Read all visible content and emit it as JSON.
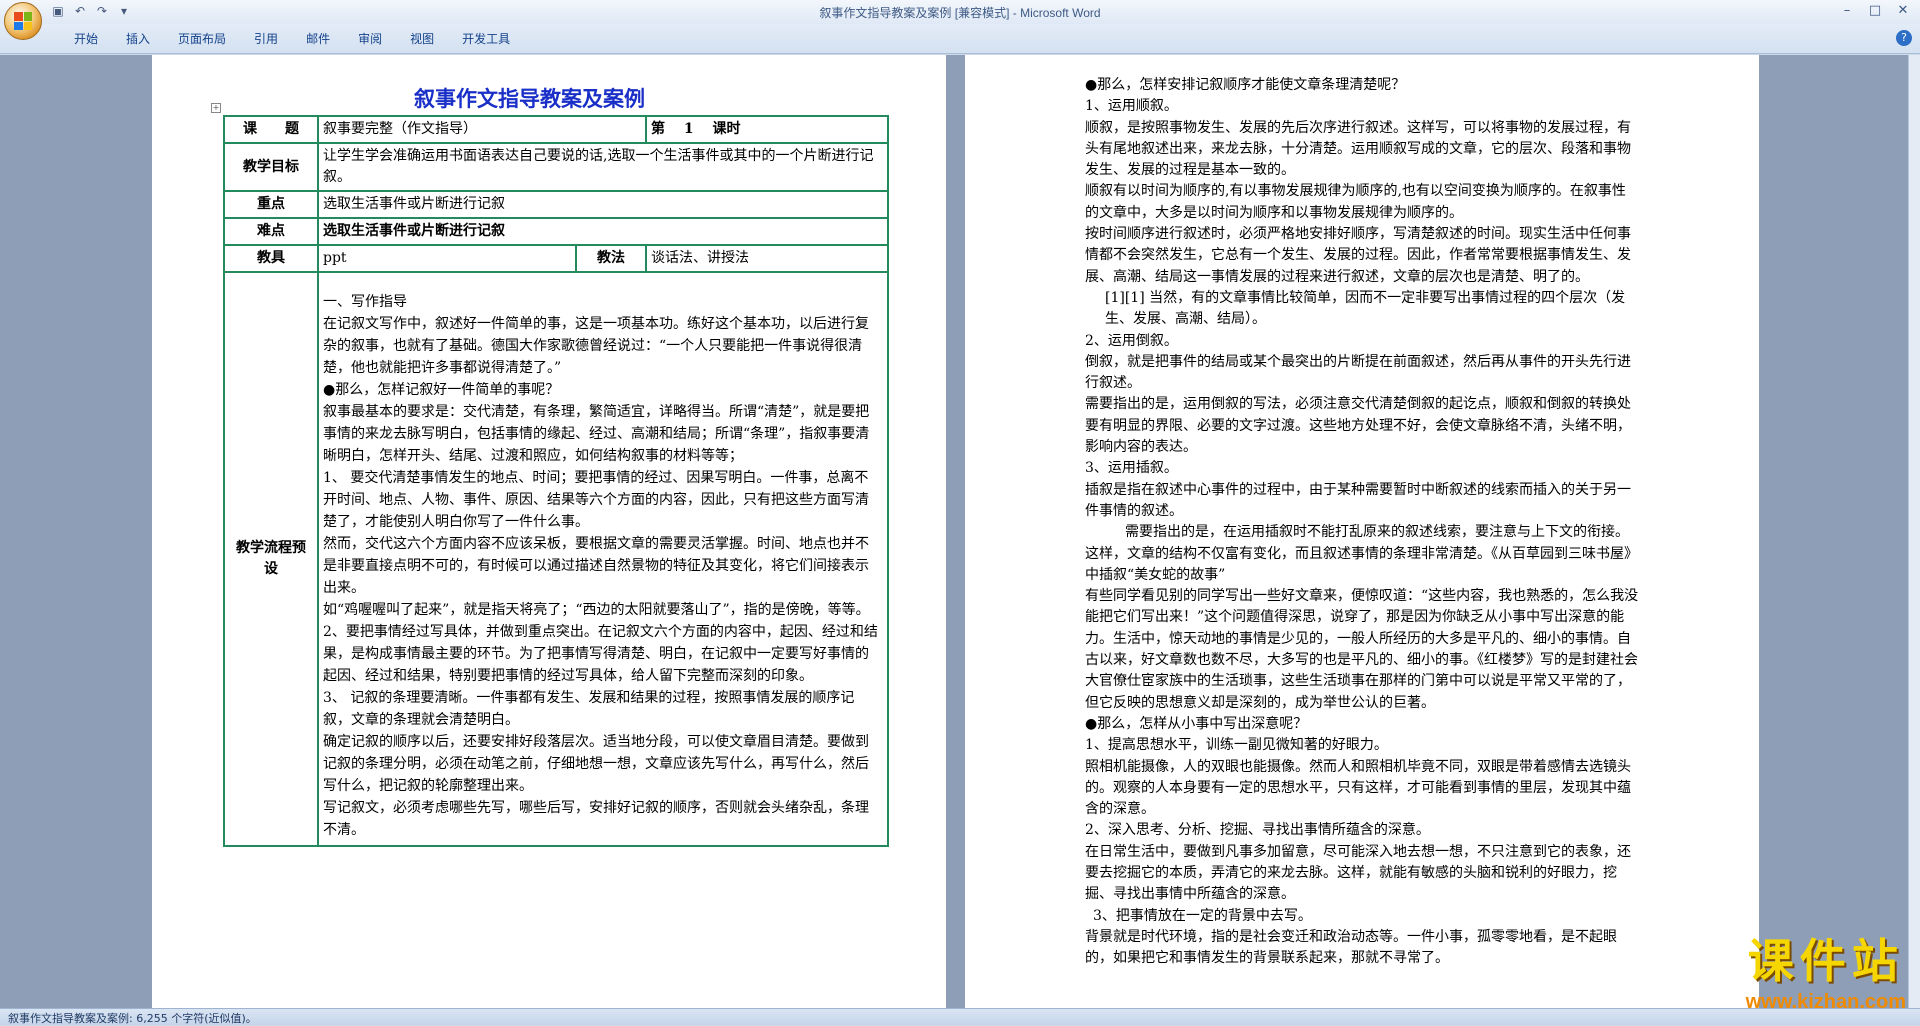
{
  "window": {
    "title": "叙事作文指导教案及案例 [兼容模式] - Microsoft Word"
  },
  "ribbon": {
    "tabs": [
      "开始",
      "插入",
      "页面布局",
      "引用",
      "邮件",
      "审阅",
      "视图",
      "开发工具"
    ]
  },
  "page1": {
    "doc_title": "叙事作文指导教案及案例",
    "table": {
      "topic_label": "课　　题",
      "topic_value": "叙事要完整（作文指导）",
      "period_label": "第　 1　 课时",
      "goal_label": "教学目标",
      "goal_value": "让学生学会准确运用书面语表达自己要说的话,选取一个生活事件或其中的一个片断进行记叙。",
      "key_label": "重点",
      "key_value": "选取生活事件或片断进行记叙",
      "difficulty_label": "难点",
      "difficulty_value": "选取生活事件或片断进行记叙",
      "tools_label": "教具",
      "tools_value": "ppt",
      "method_label": "教法",
      "method_value": "谈话法、讲授法",
      "flow_label": "教学流程预设",
      "flow_paragraphs": [
        "一、写作指导",
        "在记叙文写作中，叙述好一件简单的事，这是一项基本功。练好这个基本功，以后进行复杂的叙事，也就有了基础。德国大作家歌德曾经说过：“一个人只要能把一件事说得很清楚，他也就能把许多事都说得清楚了。”",
        "●那么，怎样记叙好一件简单的事呢？",
        "叙事最基本的要求是：交代清楚，有条理，繁简适宜，详略得当。所谓“清楚”，就是要把事情的来龙去脉写明白，包括事情的缘起、经过、高潮和结局；所谓“条理”，指叙事要清晰明白，怎样开头、结尾、过渡和照应，如何结构叙事的材料等等；",
        "1、 要交代清楚事情发生的地点、时间；要把事情的经过、因果写明白。一件事，总离不开时间、地点、人物、事件、原因、结果等六个方面的内容，因此，只有把这些方面写清楚了，才能使别人明白你写了一件什么事。",
        "然而，交代这六个方面内容不应该呆板，要根据文章的需要灵活掌握。时间、地点也并不是非要直接点明不可的，有时候可以通过描述自然景物的特征及其变化，将它们间接表示出来。",
        "如“鸡喔喔叫了起来”，就是指天将亮了；“西边的太阳就要落山了”，指的是傍晚，等等。",
        "2、要把事情经过写具体，并做到重点突出。在记叙文六个方面的内容中，起因、经过和结果，是构成事情最主要的环节。为了把事情写得清楚、明白，在记叙中一定要写好事情的起因、经过和结果，特别要把事情的经过写具体，给人留下完整而深刻的印象。",
        "3、 记叙的条理要清晰。一件事都有发生、发展和结果的过程，按照事情发展的顺序记叙，文章的条理就会清楚明白。",
        "确定记叙的顺序以后，还要安排好段落层次。适当地分段，可以使文章眉目清楚。要做到记叙的条理分明，必须在动笔之前，仔细地想一想，文章应该先写什么，再写什么，然后写什么，把记叙的轮廓整理出来。",
        "写记叙文，必须考虑哪些先写，哪些后写，安排好记叙的顺序，否则就会头绪杂乱，条理不清。"
      ]
    }
  },
  "page2": {
    "paragraphs": [
      "●那么，怎样安排记叙顺序才能使文章条理清楚呢？",
      "1、运用顺叙。",
      "顺叙，是按照事物发生、发展的先后次序进行叙述。这样写，可以将事物的发展过程，有头有尾地叙述出来，来龙去脉，十分清楚。运用顺叙写成的文章，它的层次、段落和事物发生、发展的过程是基本一致的。",
      "顺叙有以时间为顺序的,有以事物发展规律为顺序的,也有以空间变换为顺序的。在叙事性的文章中，大多是以时间为顺序和以事物发展规律为顺序的。",
      "按时间顺序进行叙述时，必须严格地安排好顺序，写清楚叙述的时间。现实生活中任何事情都不会突然发生，它总有一个发生、发展的过程。因此，作者常常要根据事情发生、发展、高潮、结局这一事情发展的过程来进行叙述，文章的层次也是清楚、明了的。",
      "[1][1] 当然，有的文章事情比较简单，因而不一定非要写出事情过程的四个层次（发生、发展、高潮、结局）。",
      "2、运用倒叙。",
      "倒叙，就是把事件的结局或某个最突出的片断提在前面叙述，然后再从事件的开头先行进行叙述。",
      "需要指出的是，运用倒叙的写法，必须注意交代清楚倒叙的起讫点，顺叙和倒叙的转换处要有明显的界限、必要的文字过渡。这些地方处理不好，会使文章脉络不清，头绪不明，影响内容的表达。",
      "3、运用插叙。",
      "插叙是指在叙述中心事件的过程中，由于某种需要暂时中断叙述的线索而插入的关于另一件事情的叙述。",
      "需要指出的是，在运用插叙时不能打乱原来的叙述线索，要注意与上下文的衔接。这样，文章的结构不仅富有变化，而且叙述事情的条理非常清楚。《从百草园到三味书屋》中插叙“美女蛇的故事”",
      "有些同学看见别的同学写出一些好文章来，便惊叹道：“这些内容，我也熟悉的，怎么我没能把它们写出来！”这个问题值得深思，说穿了，那是因为你缺乏从小事中写出深意的能力。生活中，惊天动地的事情是少见的，一般人所经历的大多是平凡的、细小的事情。自古以来，好文章数也数不尽，大多写的也是平凡的、细小的事。《红楼梦》写的是封建社会大官僚仕宦家族中的生活琐事，这些生活琐事在那样的门第中可以说是平常又平常的了，但它反映的思想意义却是深刻的，成为举世公认的巨著。",
      "●那么，怎样从小事中写出深意呢？",
      "1、提高思想水平，训练一副见微知著的好眼力。",
      "照相机能摄像，人的双眼也能摄像。然而人和照相机毕竟不同，双眼是带着感情去选镜头的。观察的人本身要有一定的思想水平，只有这样，才可能看到事情的里层，发现其中蕴含的深意。",
      "2、深入思考、分析、挖掘、寻找出事情所蕴含的深意。",
      "在日常生活中，要做到凡事多加留意，尽可能深入地去想一想，不只注意到它的表象，还要去挖掘它的本质，弄清它的来龙去脉。这样，就能有敏感的头脑和锐利的好眼力，挖掘、寻找出事情中所蕴含的深意。",
      "3、把事情放在一定的背景中去写。",
      "背景就是时代环境，指的是社会变迁和政治动态等。一件小事，孤零零地看，是不起眼的，如果把它和事情发生的背景联系起来，那就不寻常了。"
    ]
  },
  "status": {
    "text": "叙事作文指导教案及案例: 6,255 个字符(近似值)。"
  },
  "watermark": {
    "title": "课件站",
    "url": "www.kjzhan.com"
  }
}
